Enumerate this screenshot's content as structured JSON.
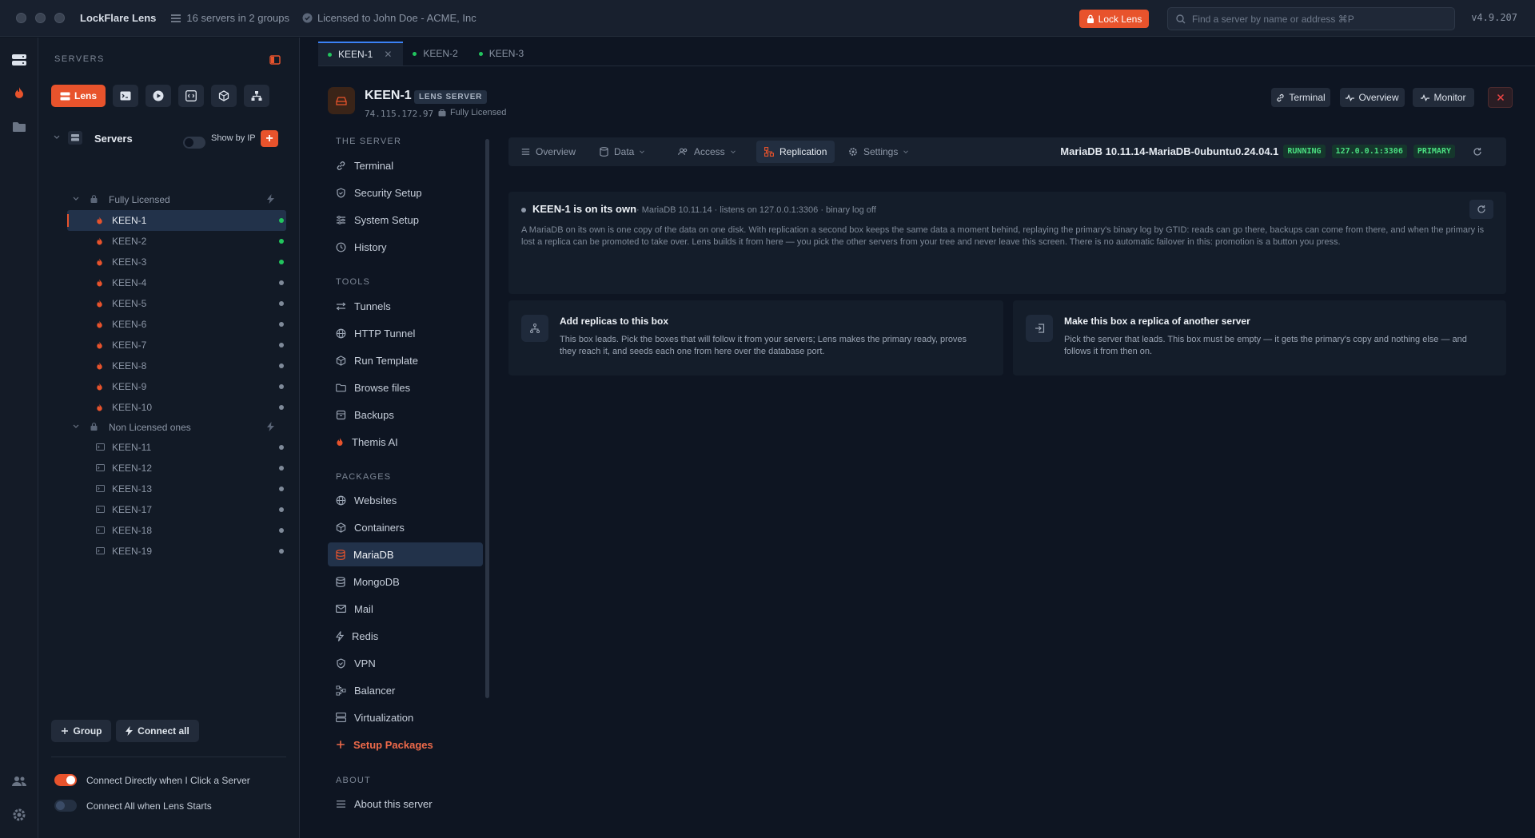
{
  "titlebar": {
    "app": "LockFlare Lens",
    "servers_meta": "16 servers in 2 groups",
    "license": "Licensed to John Doe - ACME, Inc",
    "lock_label": "Lock Lens",
    "search_placeholder": "Find a server by name or address ⌘P",
    "version": "v4.9.207"
  },
  "sidebar": {
    "section": "SERVERS",
    "lens_label": "Lens",
    "root": "Servers",
    "show_by_ip": "Show by IP",
    "groups": [
      {
        "name": "Fully Licensed",
        "servers": [
          "KEEN-1",
          "KEEN-2",
          "KEEN-3",
          "KEEN-4",
          "KEEN-5",
          "KEEN-6",
          "KEEN-7",
          "KEEN-8",
          "KEEN-9",
          "KEEN-10"
        ]
      },
      {
        "name": "Non Licensed ones",
        "servers": [
          "KEEN-11",
          "KEEN-12",
          "KEEN-13",
          "KEEN-17",
          "KEEN-18",
          "KEEN-19"
        ]
      }
    ],
    "group_btn": "Group",
    "connect_all_btn": "Connect all",
    "opt_direct": "Connect Directly when I Click a Server",
    "opt_all": "Connect All when Lens Starts"
  },
  "tabs": [
    "KEEN-1",
    "KEEN-2",
    "KEEN-3"
  ],
  "server": {
    "name": "KEEN-1",
    "badge": "LENS SERVER",
    "ip": "74.115.172.97",
    "license": "Fully Licensed"
  },
  "header_buttons": {
    "terminal": "Terminal",
    "overview": "Overview",
    "monitor": "Monitor"
  },
  "nav": {
    "sec_server": "THE SERVER",
    "server_items": [
      "Terminal",
      "Security Setup",
      "System Setup",
      "History"
    ],
    "sec_tools": "TOOLS",
    "tools_items": [
      "Tunnels",
      "HTTP Tunnel",
      "Run Template",
      "Browse files",
      "Backups",
      "Themis AI"
    ],
    "sec_packages": "PACKAGES",
    "package_items": [
      "Websites",
      "Containers",
      "MariaDB",
      "MongoDB",
      "Mail",
      "Redis",
      "VPN",
      "Balancer",
      "Virtualization"
    ],
    "setup": "Setup Packages",
    "sec_about": "ABOUT",
    "about_item": "About this server"
  },
  "subtabs": {
    "overview": "Overview",
    "data": "Data",
    "access": "Access",
    "replication": "Replication",
    "settings": "Settings"
  },
  "status": {
    "version": "MariaDB 10.11.14-MariaDB-0ubuntu0.24.04.1",
    "running": "RUNNING",
    "addr": "127.0.0.1:3306",
    "role": "PRIMARY"
  },
  "solo": {
    "title": "KEEN-1 is on its own",
    "meta": "· MariaDB 10.11.14 · listens on 127.0.0.1:3306 · binary log off",
    "desc": "A MariaDB on its own is one copy of the data on one disk. With replication a second box keeps the same data a moment behind, replaying the primary's binary log by GTID: reads can go there, backups can come from there, and when the primary is lost a replica can be promoted to take over. Lens builds it from here — you pick the other servers from your tree and never leave this screen. There is no automatic failover in this: promotion is a button you press."
  },
  "add_card": {
    "title": "Add replicas to this box",
    "desc": "This box leads. Pick the boxes that will follow it from your servers; Lens makes the primary ready, proves they reach it, and seeds each one from here over the database port."
  },
  "replica_card": {
    "title": "Make this box a replica of another server",
    "desc": "Pick the server that leads. This box must be empty — it gets the primary's copy and nothing else — and follows it from then on."
  },
  "colors": {
    "accent": "#e8532c",
    "bg": "#0e1522",
    "panel": "#121a26",
    "selected": "#22324a",
    "ok": "#22c55e"
  }
}
